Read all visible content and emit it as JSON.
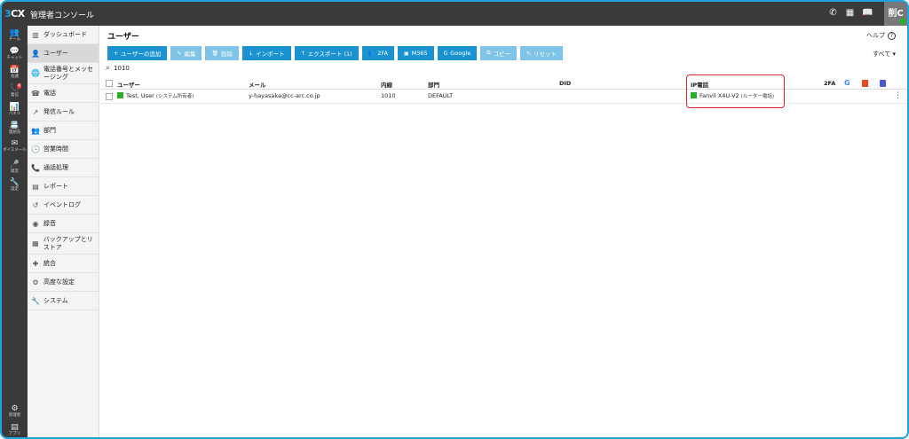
{
  "app": {
    "logo": "3CX",
    "title": "管理者コンソール",
    "user_initial": "削C"
  },
  "topbar_icons": [
    "phone-icon",
    "qr-code-icon",
    "book-icon"
  ],
  "rail": [
    {
      "name": "team",
      "label": "チーム",
      "icon": "people-icon"
    },
    {
      "name": "chat",
      "label": "チャット",
      "icon": "chat-icon"
    },
    {
      "name": "meeting",
      "label": "会議",
      "icon": "meeting-icon"
    },
    {
      "name": "calls",
      "label": "着信",
      "icon": "call-icon",
      "badge": "4"
    },
    {
      "name": "panel",
      "label": "パネル",
      "icon": "panel-icon"
    },
    {
      "name": "contacts",
      "label": "連絡先",
      "icon": "contacts-icon"
    },
    {
      "name": "voicemail",
      "label": "ボイスメール",
      "icon": "mail-icon"
    },
    {
      "name": "recording",
      "label": "録音",
      "icon": "mic-icon"
    },
    {
      "name": "settings",
      "label": "設定",
      "icon": "wrench-icon"
    },
    {
      "name": "admin",
      "label": "管理者",
      "icon": "gear-icon"
    },
    {
      "name": "apps",
      "label": "アプリ",
      "icon": "apps-icon"
    }
  ],
  "nav": [
    {
      "label": "ダッシュボード",
      "icon": "dashboard-icon"
    },
    {
      "label": "ユーザー",
      "icon": "user-icon",
      "active": true
    },
    {
      "label": "電話番号とメッセージング",
      "icon": "globe-icon"
    },
    {
      "label": "電話",
      "icon": "phone-device-icon"
    },
    {
      "label": "発信ルール",
      "icon": "outbound-icon"
    },
    {
      "label": "部門",
      "icon": "department-icon"
    },
    {
      "label": "営業時間",
      "icon": "clock-icon"
    },
    {
      "label": "通話処理",
      "icon": "call-handling-icon"
    },
    {
      "label": "レポート",
      "icon": "report-icon"
    },
    {
      "label": "イベントログ",
      "icon": "history-icon"
    },
    {
      "label": "録音",
      "icon": "record-icon"
    },
    {
      "label": "バックアップとリストア",
      "icon": "backup-icon"
    },
    {
      "label": "統合",
      "icon": "puzzle-icon"
    },
    {
      "label": "高度な設定",
      "icon": "cog-icon"
    },
    {
      "label": "システム",
      "icon": "wrench-icon"
    }
  ],
  "main": {
    "title": "ユーザー",
    "help": "ヘルプ",
    "help_icon": "?",
    "filter": "すべて",
    "search_value": "1010",
    "toolbar": [
      {
        "label": "ユーザーの追加",
        "icon": "+",
        "disabled": false
      },
      {
        "label": "編集",
        "icon": "✎",
        "disabled": true
      },
      {
        "label": "削除",
        "icon": "🗑",
        "disabled": true
      },
      {
        "label": "インポート",
        "icon": "↓",
        "disabled": false
      },
      {
        "label": "エクスポート (1)",
        "icon": "↑",
        "disabled": false
      },
      {
        "label": "2FA",
        "icon": "👥",
        "disabled": false
      },
      {
        "label": "M365",
        "icon": "▣",
        "disabled": false
      },
      {
        "label": "Google",
        "icon": "G",
        "disabled": false
      },
      {
        "label": "コピー",
        "icon": "⧉",
        "disabled": true
      },
      {
        "label": "リセット",
        "icon": "↻",
        "disabled": true
      }
    ],
    "columns": {
      "user": "ユーザー",
      "email": "メール",
      "extension": "内線",
      "department": "部門",
      "did": "DID",
      "ip_phone": "IP電話",
      "twofa": "2FA"
    },
    "rows": [
      {
        "user": "Test, User",
        "user_note": "(システム所有者)",
        "email": "y-hayasaka@cc-arc.co.jp",
        "extension": "1010",
        "department": "DEFAULT",
        "did": "",
        "ip_phone": "Fanvil X4U-V2",
        "ip_phone_note": "(ルーター電話)",
        "status_color": "#2aae2a"
      }
    ]
  },
  "colors": {
    "accent": "#1a93d0",
    "topbar": "#3a3a3a",
    "highlight": "#d9232e",
    "online": "#2aae2a"
  }
}
